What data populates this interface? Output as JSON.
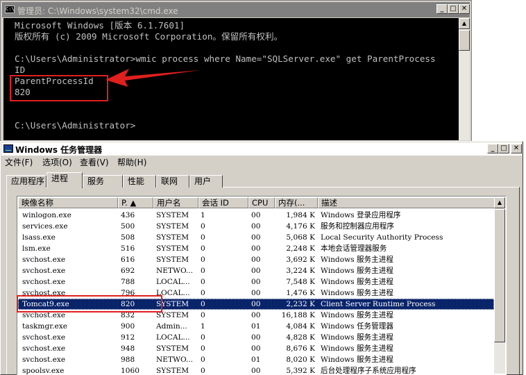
{
  "cmd": {
    "title": "管理员: C:\\Windows\\system32\\cmd.exe",
    "icon_text": "C:\\",
    "lines": [
      "Microsoft Windows [版本 6.1.7601]",
      "版权所有 (c) 2009 Microsoft Corporation。保留所有权利。",
      "",
      "C:\\Users\\Administrator>wmic process where Name=\"SQLServer.exe\" get ParentProcess",
      "ID",
      "ParentProcessId",
      "820",
      "",
      "",
      "C:\\Users\\Administrator>"
    ],
    "buttons": {
      "minimize": "_",
      "maximize": "□",
      "close": "✕"
    }
  },
  "taskmgr": {
    "title": "Windows 任务管理器",
    "buttons": {
      "minimize": "_",
      "maximize": "□",
      "close": "✕"
    },
    "menu": [
      "文件(F)",
      "选项(O)",
      "查看(V)",
      "帮助(H)"
    ],
    "tabs": [
      "应用程序",
      "进程",
      "服务",
      "性能",
      "联网",
      "用户"
    ],
    "active_tab": 1,
    "columns": [
      "映像名称",
      "P. ▲",
      "用户名",
      "会话 ID",
      "CPU",
      "内存(...",
      "描述"
    ],
    "rows": [
      [
        "winlogon.exe",
        "436",
        "SYSTEM",
        "1",
        "00",
        "1,984 K",
        "Windows 登录应用程序"
      ],
      [
        "services.exe",
        "500",
        "SYSTEM",
        "0",
        "00",
        "4,176 K",
        "服务和控制器应用程序"
      ],
      [
        "lsass.exe",
        "508",
        "SYSTEM",
        "0",
        "00",
        "5,068 K",
        "Local Security Authority Process"
      ],
      [
        "lsm.exe",
        "516",
        "SYSTEM",
        "0",
        "00",
        "2,248 K",
        "本地会话管理器服务"
      ],
      [
        "svchost.exe",
        "616",
        "SYSTEM",
        "0",
        "00",
        "3,692 K",
        "Windows 服务主进程"
      ],
      [
        "svchost.exe",
        "692",
        "NETWO...",
        "0",
        "00",
        "3,224 K",
        "Windows 服务主进程"
      ],
      [
        "svchost.exe",
        "788",
        "LOCAL...",
        "0",
        "00",
        "7,548 K",
        "Windows 服务主进程"
      ],
      [
        "svchost.exe",
        "796",
        "LOCAL...",
        "0",
        "00",
        "1,476 K",
        "Windows 服务主进程"
      ],
      [
        "Tomcat9.exe",
        "820",
        "SYSTEM",
        "0",
        "00",
        "2,232 K",
        "Client Server Runtime Process"
      ],
      [
        "svchost.exe",
        "832",
        "SYSTEM",
        "0",
        "00",
        "16,188 K",
        "Windows 服务主进程"
      ],
      [
        "taskmgr.exe",
        "900",
        "Admin...",
        "1",
        "01",
        "4,084 K",
        "Windows 任务管理器"
      ],
      [
        "svchost.exe",
        "912",
        "LOCAL...",
        "0",
        "00",
        "4,828 K",
        "Windows 服务主进程"
      ],
      [
        "svchost.exe",
        "948",
        "SYSTEM",
        "0",
        "00",
        "8,676 K",
        "Windows 服务主进程"
      ],
      [
        "svchost.exe",
        "988",
        "NETWO...",
        "0",
        "01",
        "8,020 K",
        "Windows 服务主进程"
      ],
      [
        "spoolsv.exe",
        "1060",
        "SYSTEM",
        "0",
        "00",
        "5,392 K",
        "后台处理程序子系统应用程序"
      ]
    ],
    "selected_row": 8
  },
  "colors": {
    "annotation_red": "#e0201e",
    "selection": "#0a246a",
    "console_bg": "#000000",
    "console_text": "#c0c0c0"
  }
}
